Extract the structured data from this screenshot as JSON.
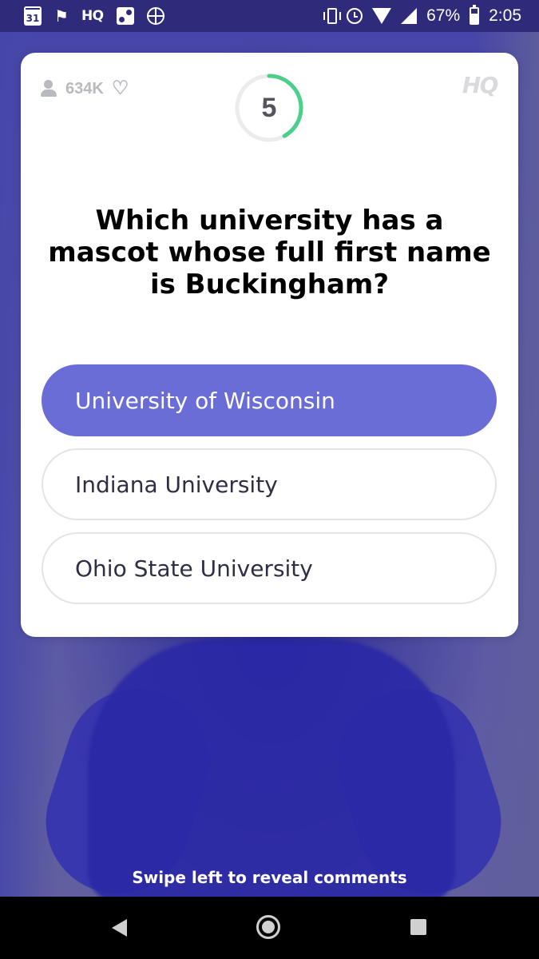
{
  "status_bar": {
    "calendar_day": "31",
    "app_badge": "HQ",
    "battery_percent": "67%",
    "time": "2:05",
    "icons": [
      "calendar-icon",
      "flag-icon",
      "hq-icon",
      "dice-icon",
      "basketball-icon",
      "vibrate-icon",
      "alarm-icon",
      "wifi-icon",
      "signal-icon",
      "battery-icon"
    ]
  },
  "card": {
    "viewer_count": "634K",
    "logo": "HQ",
    "timer": {
      "value": "5",
      "progress_fraction": 0.42,
      "color": "#4ccf8a"
    },
    "question": "Which university has a mascot whose full first name is Buckingham?",
    "answers": [
      {
        "label": "University of Wisconsin",
        "selected": true
      },
      {
        "label": "Indiana University",
        "selected": false
      },
      {
        "label": "Ohio State University",
        "selected": false
      }
    ]
  },
  "footer": {
    "swipe_hint": "Swipe left to reveal comments"
  },
  "colors": {
    "selected_answer": "#6b6dd6",
    "background": "#3b3a96"
  }
}
